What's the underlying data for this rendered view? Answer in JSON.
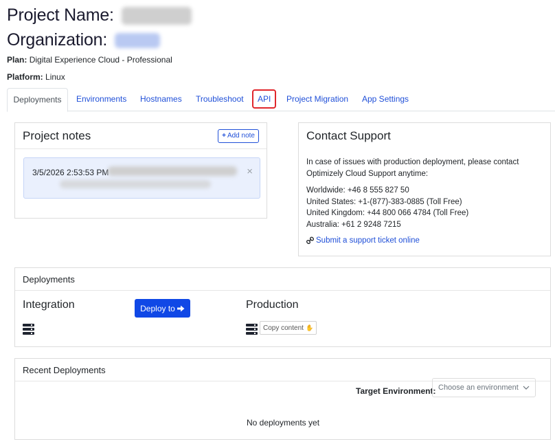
{
  "header": {
    "project_label": "Project Name:",
    "organization_label": "Organization:",
    "plan_label": "Plan:",
    "plan_value": "Digital Experience Cloud - Professional",
    "platform_label": "Platform:",
    "platform_value": "Linux"
  },
  "tabs": [
    {
      "label": "Deployments",
      "active": true
    },
    {
      "label": "Environments"
    },
    {
      "label": "Hostnames"
    },
    {
      "label": "Troubleshoot"
    },
    {
      "label": "API",
      "highlighted": true
    },
    {
      "label": "Project Migration"
    },
    {
      "label": "App Settings"
    }
  ],
  "project_notes": {
    "title": "Project notes",
    "add_note_label": "Add note",
    "note_date": "3/5/2026 2:53:53 PM",
    "close_symbol": "×"
  },
  "contact_support": {
    "title": "Contact Support",
    "intro_line1": "In case of issues with production deployment, please contact",
    "intro_line2": "Optimizely Cloud Support anytime:",
    "worldwide": "Worldwide: +46 8 555 827 50",
    "united_states": "United States: +1-(877)-383-0885 (Toll Free)",
    "united_kingdom": "United Kingdom: +44 800 066 4784 (Toll Free)",
    "australia": "Australia: +61 2 9248 7215",
    "ticket_link": "Submit a support ticket online"
  },
  "deployments": {
    "title": "Deployments",
    "integration_label": "Integration",
    "production_label": "Production",
    "deploy_button": "Deploy to",
    "copy_button": "Copy content"
  },
  "recent_deployments": {
    "title": "Recent Deployments",
    "target_label": "Target Environment:",
    "select_placeholder": "Choose an environment",
    "empty_text": "No deployments yet"
  },
  "icons": {
    "server": "server-icon",
    "link": "link-icon",
    "arrow": "arrow-right-icon",
    "hand": "hand-icon",
    "chevron": "chevron-down-icon"
  },
  "colors": {
    "link_blue": "#1f4fd8",
    "primary_button": "#1048e6",
    "highlight_red": "#e0262b"
  }
}
